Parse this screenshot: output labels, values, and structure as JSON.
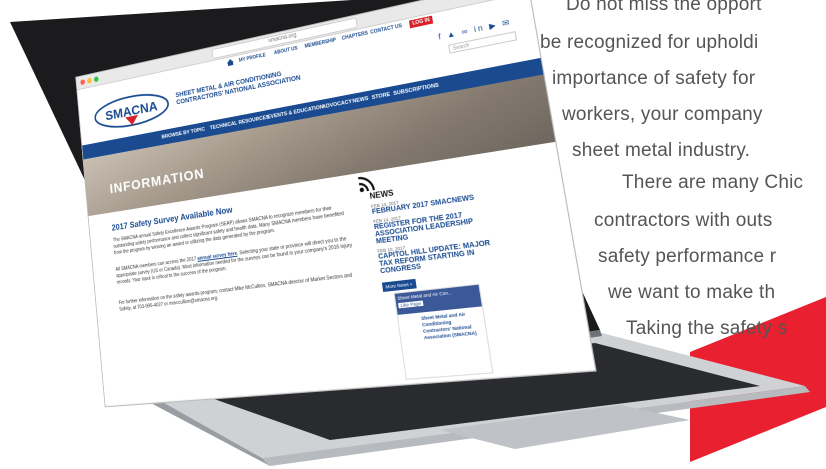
{
  "side_text": {
    "lines": [
      "Do not miss the opport",
      "be recognized for upholdi",
      "importance of safety for",
      "workers, your company",
      "sheet metal industry.",
      "There are many Chic",
      "contractors with outs",
      "safety performance r",
      "we want to make th",
      "Taking the safety s"
    ]
  },
  "browser": {
    "address": "smacna.org"
  },
  "site": {
    "top_nav": [
      "MY PROFILE",
      "ABOUT US",
      "MEMBERSHIP",
      "CHAPTERS",
      "CONTACT US"
    ],
    "login_label": "LOG IN",
    "logo_text": "SMACNA",
    "org_name_line1": "SHEET METAL & AIR CONDITIONING",
    "org_name_line2": "CONTRACTORS' NATIONAL ASSOCIATION",
    "social_icons": "f  ▲  ∞  in  ▶  ✉",
    "search_placeholder": "Search",
    "main_nav": [
      "BROWSE BY TOPIC",
      "TECHNICAL RESOURCES",
      "EVENTS & EDUCATION",
      "ADVOCACY",
      "NEWS",
      "STORE",
      "SUBSCRIPTIONS"
    ],
    "hero_title": "INFORMATION",
    "article": {
      "title": "2017 Safety Survey Available Now",
      "p1": "The SMACNA annual Safety Excellence Awards Program (SEAP) allows SMACNA to recognize members for their outstanding safety performance and collect significant safety and health data. Many SMACNA members have benefited from the program by winning an award or utilizing the data generated by the program.",
      "p2_prefix": "All SMACNA members can access the 2017",
      "p2_link": "annual survey here",
      "p2_suffix": ". Selecting your state or province will direct you to the appropriate survey (US or Canada). Most information needed for the surveys can be found in your company's 2016 injury records. Your input is critical to the success of the program.",
      "p3": "For further information on the safety awards program, contact Mike McCullion, SMACNA director of Market Sectors and Safety, at 703-995-4027 or mmccullion@smacna.org."
    },
    "news": {
      "heading": "NEWS",
      "items": [
        {
          "date": "FEB 14, 2017",
          "title": "FEBRUARY 2017 SMACNEWS"
        },
        {
          "date": "FEB 14, 2017",
          "title": "REGISTER FOR THE 2017 ASSOCIATION LEADERSHIP MEETING"
        },
        {
          "date": "FEB 10, 2017",
          "title": "CAPITOL HILL UPDATE: MAJOR TAX REFORM STARTING IN CONGRESS"
        }
      ],
      "more_label": "More News »"
    },
    "fb_card": {
      "banner": "Sheet Metal and Air Con...",
      "like_label": "Like Page",
      "org": "Sheet Metal and Air Conditioning Contractors' National Association (SMACNA)"
    }
  },
  "colors": {
    "brand_blue": "#1a4b91",
    "brand_red": "#d6232b",
    "accent_red": "#e8202f"
  }
}
